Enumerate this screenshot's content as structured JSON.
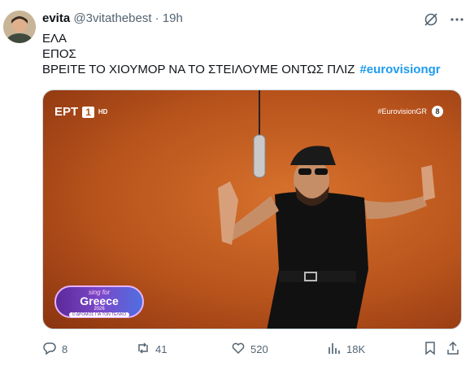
{
  "author": {
    "display_name": "evita",
    "handle": "@3vitathebest",
    "separator": "·",
    "time": "19h"
  },
  "tweet": {
    "lines": [
      "ΕΛΑ",
      "ΕΠΟΣ",
      "ΒΡΕΙΤΕ ΤΟ ΧΙΟΥΜΟΡ ΝΑ ΤΟ ΣΤΕΙΛΟΥΜΕ ΟΝΤΩΣ ΠΛΙΖ"
    ],
    "hashtag": "#eurovisiongr"
  },
  "media": {
    "channel_logo": "ΕΡΤ",
    "channel_number": "1",
    "channel_hd": "HD",
    "channel_tag": "#EurovisionGR",
    "rating": "8",
    "badge": {
      "line1": "sing for",
      "line2": "Greece",
      "line3": "2026",
      "line4": "Ο ΔΡΟΜΟΣ ΓΙΑ ΤΟΝ ΤΕΛΙΚΟ"
    }
  },
  "actions": {
    "replies": "8",
    "reposts": "41",
    "likes": "520",
    "views": "18K"
  },
  "colors": {
    "accent": "#1d9bf0",
    "muted": "#536471",
    "media_bg": "#c0571f"
  },
  "icons": [
    "grok-icon",
    "more-icon",
    "reply-icon",
    "repost-icon",
    "like-icon",
    "views-icon",
    "bookmark-icon",
    "share-icon"
  ]
}
